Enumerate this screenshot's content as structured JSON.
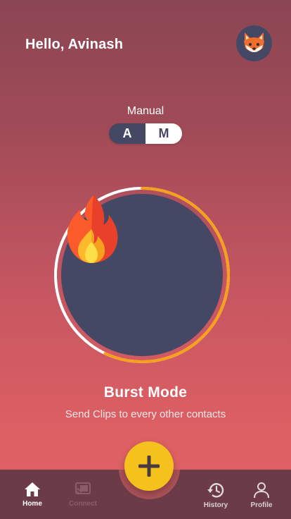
{
  "header": {
    "greeting": "Hello, Avinash",
    "avatar_icon": "fox-avatar-icon"
  },
  "mode_switch": {
    "label": "Manual",
    "option_auto": "A",
    "option_manual": "M",
    "selected": "M"
  },
  "burst": {
    "icon": "fire-icon",
    "title": "Burst Mode",
    "description": "Send Clips to every other contacts",
    "ring_progress": 0.57
  },
  "fab": {
    "icon": "plus-icon"
  },
  "nav": {
    "items": [
      {
        "label": "Home",
        "icon": "home-icon",
        "active": true
      },
      {
        "label": "Connect",
        "icon": "cast-icon",
        "active": false,
        "disabled": true
      },
      {
        "label": "History",
        "icon": "history-icon",
        "active": false
      },
      {
        "label": "Profile",
        "icon": "person-icon",
        "active": false
      }
    ]
  },
  "colors": {
    "accent": "#f5c11d",
    "ring_orange": "#f7a11a",
    "dark": "#454864",
    "navbar": "#6b3c47"
  }
}
